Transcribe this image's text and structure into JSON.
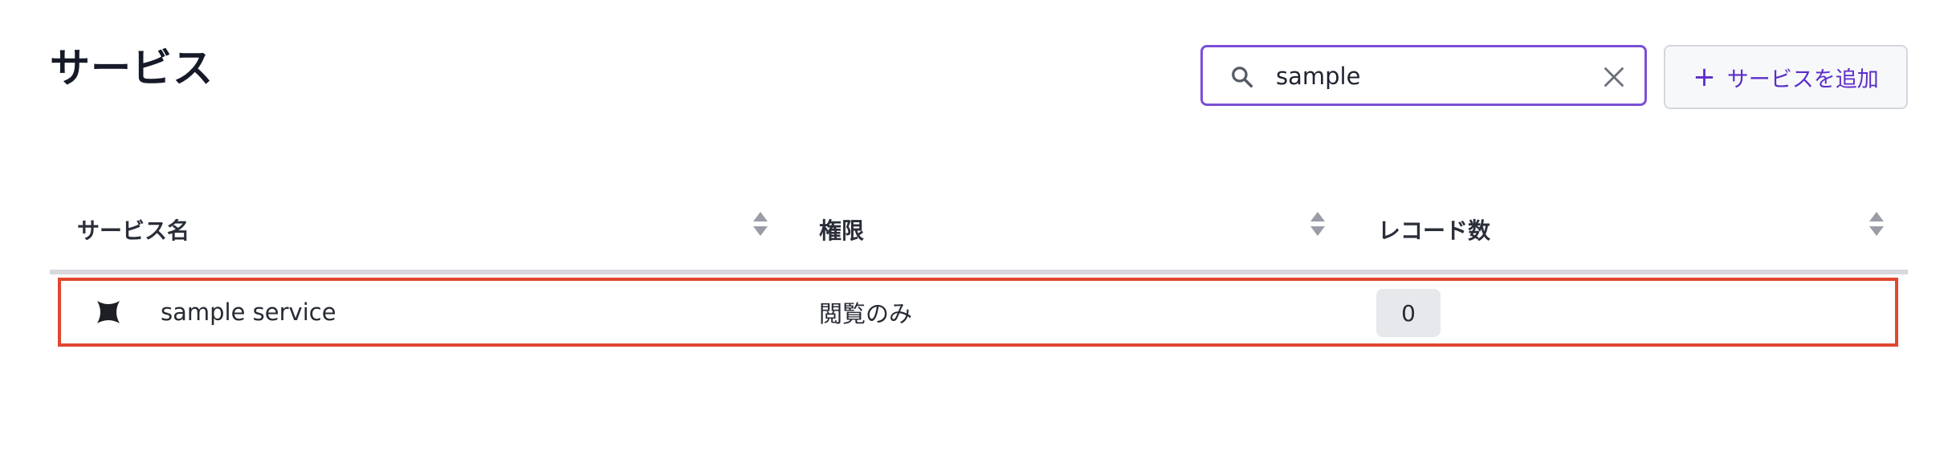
{
  "page": {
    "title": "サービス"
  },
  "search": {
    "value": "sample",
    "placeholder": "",
    "icon": "search-icon",
    "clear_icon": "close-icon"
  },
  "toolbar": {
    "add_label": "サービスを追加",
    "add_icon": "plus-icon",
    "accent_color": "#5b2ec8"
  },
  "table": {
    "columns": [
      {
        "label": "サービス名",
        "sortable": true
      },
      {
        "label": "権限",
        "sortable": true
      },
      {
        "label": "レコード数",
        "sortable": true
      }
    ],
    "rows": [
      {
        "icon": "sparkle-icon",
        "name": "sample service",
        "permission": "閲覧のみ",
        "record_count": "0",
        "highlighted": true
      }
    ]
  },
  "colors": {
    "highlight_border": "#e0472f",
    "search_border": "#7b4fd6"
  }
}
